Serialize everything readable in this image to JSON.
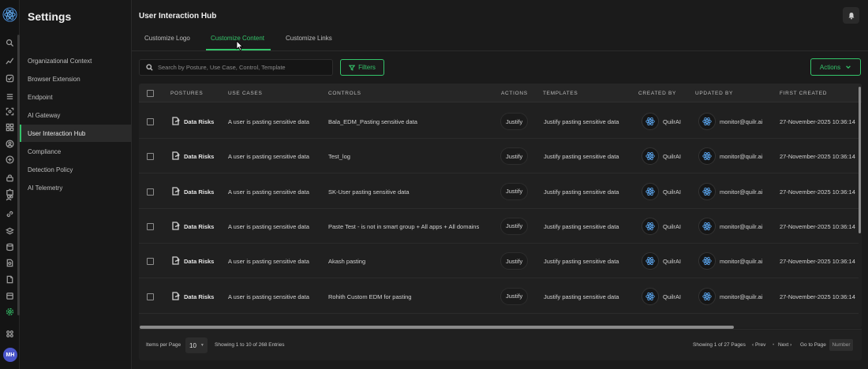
{
  "app": {
    "avatar_initials": "MH",
    "colors": {
      "accent": "#34c46a",
      "background": "#1b1b1b",
      "avatar": "#4a55c9"
    }
  },
  "rail": {
    "icons": [
      "search-icon",
      "chart-icon",
      "shield-check-icon",
      "bars-icon",
      "scan-icon",
      "grid-icon",
      "user-circle-icon",
      "sliders-icon",
      "lock-icon",
      "puzzle-icon",
      "users-icon",
      "link-icon",
      "layers-icon",
      "database-icon",
      "document-search-icon",
      "file-icon",
      "frame-icon",
      "settings-gear-icon",
      "apps-icon"
    ]
  },
  "sidebar": {
    "title": "Settings",
    "items": [
      {
        "label": "Organizational Context"
      },
      {
        "label": "Browser Extension"
      },
      {
        "label": "Endpoint"
      },
      {
        "label": "AI Gateway"
      },
      {
        "label": "User Interaction Hub"
      },
      {
        "label": "Compliance"
      },
      {
        "label": "Detection Policy"
      },
      {
        "label": "AI Telemetry"
      }
    ],
    "active_index": 4
  },
  "header": {
    "title": "User Interaction Hub"
  },
  "tabs": [
    {
      "label": "Customize Logo"
    },
    {
      "label": "Customize Content"
    },
    {
      "label": "Customize Links"
    }
  ],
  "toolbar": {
    "search_placeholder": "Search by Posture, Use Case, Control, Template",
    "filters_label": "Filters",
    "actions_label": "Actions"
  },
  "table": {
    "columns": [
      "POSTURES",
      "USE CASES",
      "CONTROLS",
      "ACTIONS",
      "TEMPLATES",
      "CREATED BY",
      "UPDATED BY",
      "FIRST CREATED"
    ],
    "rows": [
      {
        "posture": "Data Risks",
        "use_case": "A user is pasting sensitive data",
        "control": "Bala_EDM_Pasting sensitive data",
        "action": "Justify",
        "template": "Justify pasting sensitive data",
        "created_by": "QuilrAI",
        "updated_by": "monitor@quilr.ai",
        "first_created": "27-November-2025 10:36:14"
      },
      {
        "posture": "Data Risks",
        "use_case": "A user is pasting sensitive data",
        "control": "Test_log",
        "action": "Justify",
        "template": "Justify pasting sensitive data",
        "created_by": "QuilrAI",
        "updated_by": "monitor@quilr.ai",
        "first_created": "27-November-2025 10:36:14"
      },
      {
        "posture": "Data Risks",
        "use_case": "A user is pasting sensitive data",
        "control": "SK-User pasting sensitive data",
        "action": "Justify",
        "template": "Justify pasting sensitive data",
        "created_by": "QuilrAI",
        "updated_by": "monitor@quilr.ai",
        "first_created": "27-November-2025 10:36:14"
      },
      {
        "posture": "Data Risks",
        "use_case": "A user is pasting sensitive data",
        "control": "Paste Test - is not in smart group + All apps + All domains",
        "action": "Justify",
        "template": "Justify pasting sensitive data",
        "created_by": "QuilrAI",
        "updated_by": "monitor@quilr.ai",
        "first_created": "27-November-2025 10:36:14"
      },
      {
        "posture": "Data Risks",
        "use_case": "A user is pasting sensitive data",
        "control": "Akash pasting",
        "action": "Justify",
        "template": "Justify pasting sensitive data",
        "created_by": "QuilrAI",
        "updated_by": "monitor@quilr.ai",
        "first_created": "27-November-2025 10:36:14"
      },
      {
        "posture": "Data Risks",
        "use_case": "A user is pasting sensitive data",
        "control": "Rohith Custom EDM for pasting",
        "action": "Justify",
        "template": "Justify pasting sensitive data",
        "created_by": "QuilrAI",
        "updated_by": "monitor@quilr.ai",
        "first_created": "27-November-2025 10:36:14"
      }
    ]
  },
  "footer": {
    "items_per_page_label": "Items per Page",
    "items_per_page_value": "10",
    "showing_entries": "Showing 1 to 10 of 268 Entries",
    "showing_pages": "Showing 1 of 27 Pages",
    "prev_label": "‹ Prev",
    "next_label": "Next ›",
    "go_to_label": "Go to Page",
    "page_placeholder": "Number"
  }
}
